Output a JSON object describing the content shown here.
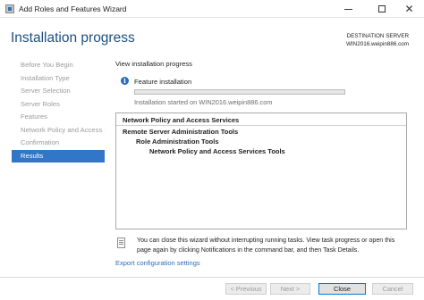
{
  "window": {
    "title": "Add Roles and Features Wizard",
    "icons": {
      "app": "server-manager-icon",
      "minimize": "minimize-icon",
      "maximize": "maximize-icon",
      "close": "close-icon"
    }
  },
  "header": {
    "title": "Installation progress",
    "destination_label": "DESTINATION SERVER",
    "destination_server": "WIN2016.weipin886.com"
  },
  "nav": {
    "items": [
      {
        "label": "Before You Begin",
        "active": false
      },
      {
        "label": "Installation Type",
        "active": false
      },
      {
        "label": "Server Selection",
        "active": false
      },
      {
        "label": "Server Roles",
        "active": false
      },
      {
        "label": "Features",
        "active": false
      },
      {
        "label": "Network Policy and Access Se...",
        "active": false
      },
      {
        "label": "Confirmation",
        "active": false
      },
      {
        "label": "Results",
        "active": true
      }
    ],
    "active_color": "#3277c7"
  },
  "main": {
    "section_title": "View installation progress",
    "status_icon": "info-icon",
    "status_label": "Feature installation",
    "progress_fraction": 0.0,
    "install_started": "Installation started on WIN2016.weipin886.com",
    "results": [
      "Network Policy and Access Services",
      "Remote Server Administration Tools",
      "Role Administration Tools",
      "Network Policy and Access Services Tools"
    ],
    "note_icon": "notification-icon",
    "note_text": "You can close this wizard without interrupting running tasks. View task progress or open this page again by clicking Notifications in the command bar, and then Task Details.",
    "export_link": "Export configuration settings"
  },
  "footer": {
    "previous": "< Previous",
    "next": "Next >",
    "close": "Close",
    "cancel": "Cancel"
  },
  "colors": {
    "title": "#1e4f7e",
    "link": "#2a6cc0",
    "accent": "#0078d7"
  }
}
